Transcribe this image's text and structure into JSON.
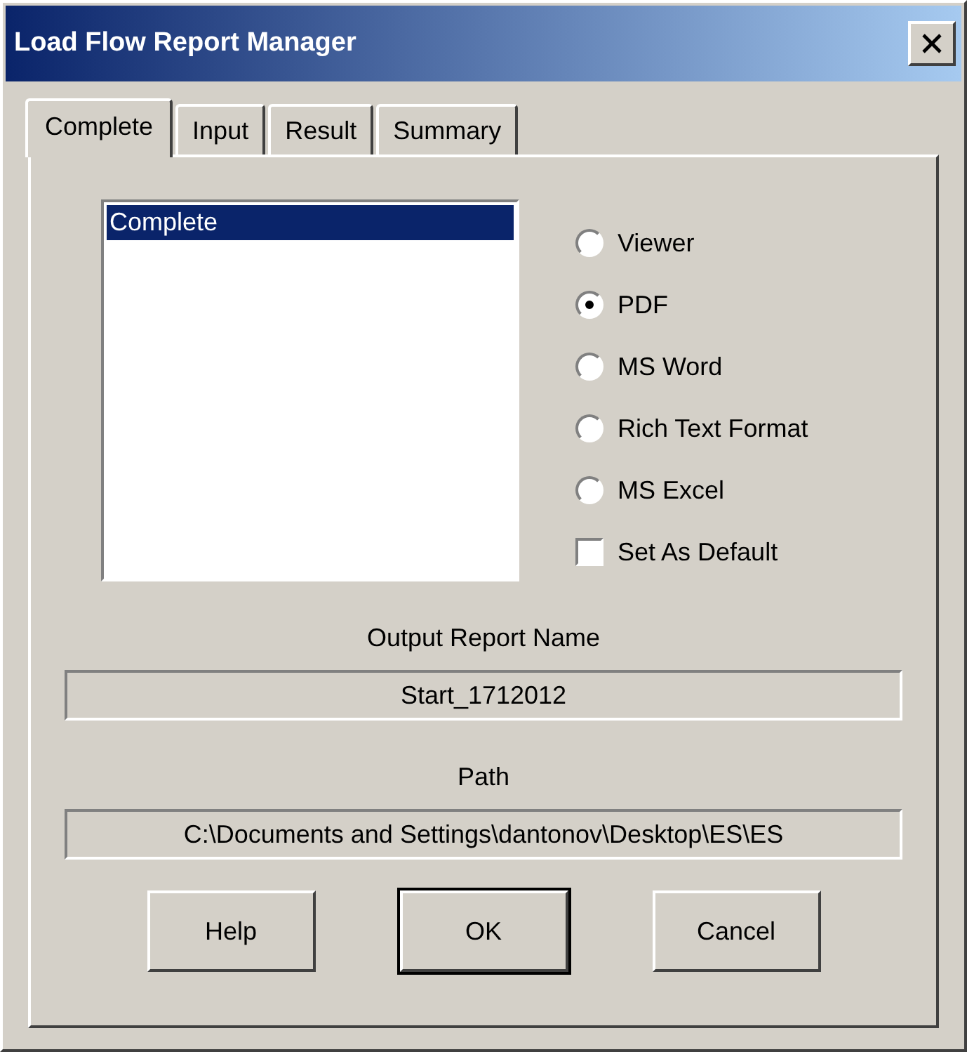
{
  "window": {
    "title": "Load Flow Report Manager"
  },
  "tabs": [
    {
      "label": "Complete",
      "selected": true
    },
    {
      "label": "Input",
      "selected": false
    },
    {
      "label": "Result",
      "selected": false
    },
    {
      "label": "Summary",
      "selected": false
    }
  ],
  "report_list": [
    {
      "label": "Complete",
      "selected": true
    }
  ],
  "formats": [
    {
      "label": "Viewer",
      "selected": false
    },
    {
      "label": "PDF",
      "selected": true
    },
    {
      "label": "MS Word",
      "selected": false
    },
    {
      "label": "Rich Text Format",
      "selected": false
    },
    {
      "label": "MS Excel",
      "selected": false
    }
  ],
  "set_as_default": {
    "label": "Set As Default",
    "checked": false
  },
  "fields": [
    {
      "label": "Output Report Name",
      "value": "Start_1712012"
    },
    {
      "label": "Path",
      "value": "C:\\Documents and Settings\\dantonov\\Desktop\\ES\\ES"
    }
  ],
  "buttons": [
    {
      "label": "Help",
      "default": false
    },
    {
      "label": "OK",
      "default": true
    },
    {
      "label": "Cancel",
      "default": false
    }
  ]
}
